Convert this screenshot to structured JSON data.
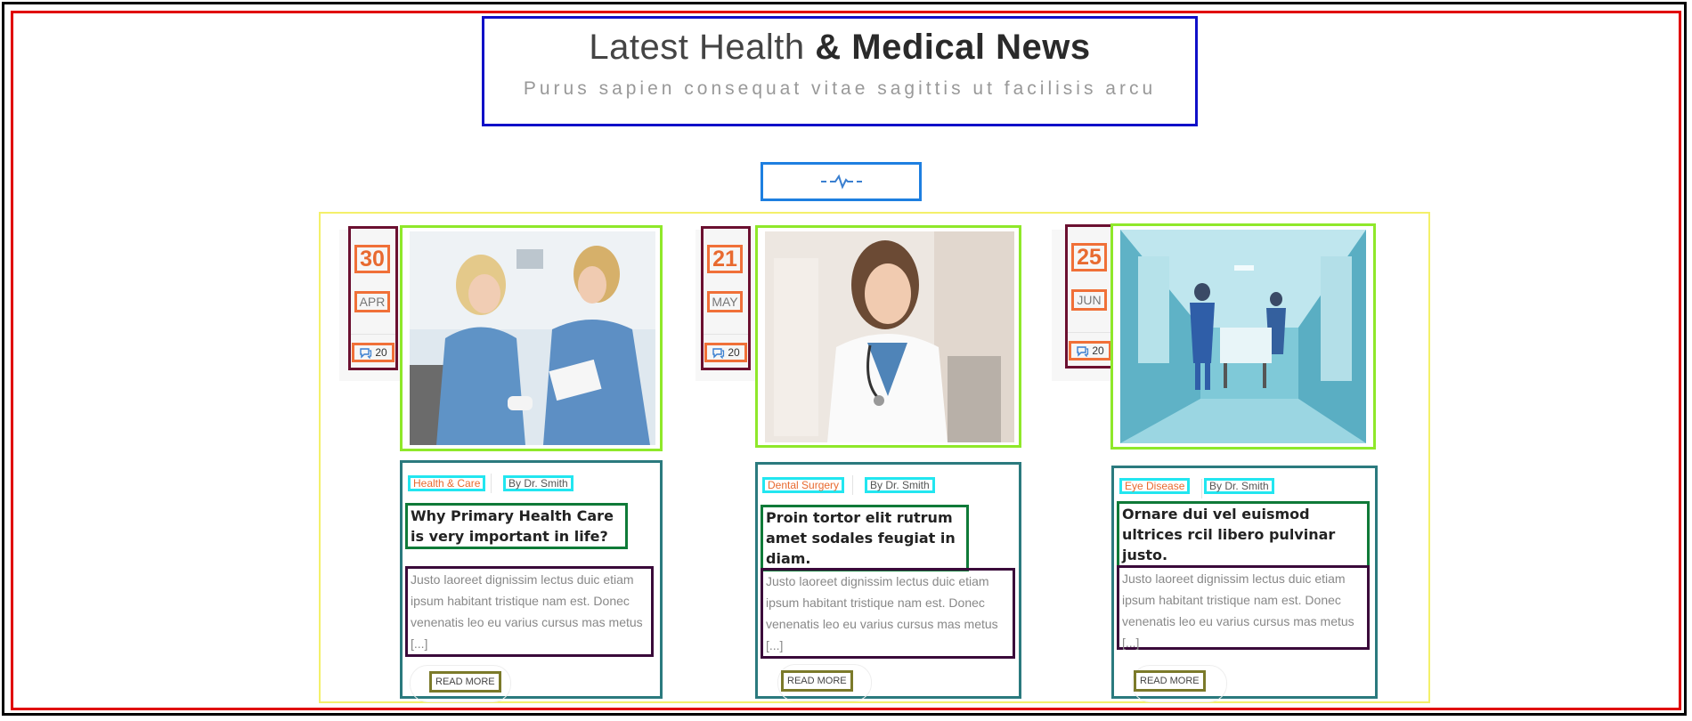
{
  "header": {
    "title_light": "Latest Health",
    "title_bold": "& Medical News",
    "subtitle": "Purus sapien consequat vitae sagittis ut facilisis arcu"
  },
  "divider": {
    "icon": "heartbeat-icon",
    "color": "#3a7fd0"
  },
  "posts": [
    {
      "day": "30",
      "month": "APR",
      "comments": "20",
      "image": "nurses-with-clipboard-photo",
      "category": "Health & Care",
      "author": "By Dr. Smith",
      "headline": "Why Primary Health Care is very important in life?",
      "excerpt": "Justo laoreet dignissim lectus duic etiam ipsum habitant tristique nam est. Donec venenatis leo eu varius cursus mas metus [...]",
      "read_more": "READ MORE"
    },
    {
      "day": "21",
      "month": "MAY",
      "comments": "20",
      "image": "female-doctor-photo",
      "category": "Dental Surgery",
      "author": "By Dr. Smith",
      "headline": "Proin tortor elit rutrum amet sodales feugiat in diam.",
      "excerpt": "Justo laoreet dignissim lectus duic etiam ipsum habitant tristique nam est. Donec venenatis leo eu varius cursus mas metus [...]",
      "read_more": "READ MORE"
    },
    {
      "day": "25",
      "month": "JUN",
      "comments": "20",
      "image": "hospital-corridor-photo",
      "category": "Eye Disease",
      "author": "By Dr. Smith",
      "headline": "Ornare dui vel euismod ultrices rcil libero pulvinar justo.",
      "excerpt": "Justo laoreet dignissim lectus duic etiam ipsum habitant tristique nam est. Donec venenatis leo eu varius cursus mas metus [...]",
      "read_more": "READ MORE"
    }
  ],
  "colors": {
    "accent": "#e86a30",
    "text": "#222222",
    "muted": "#888888"
  }
}
